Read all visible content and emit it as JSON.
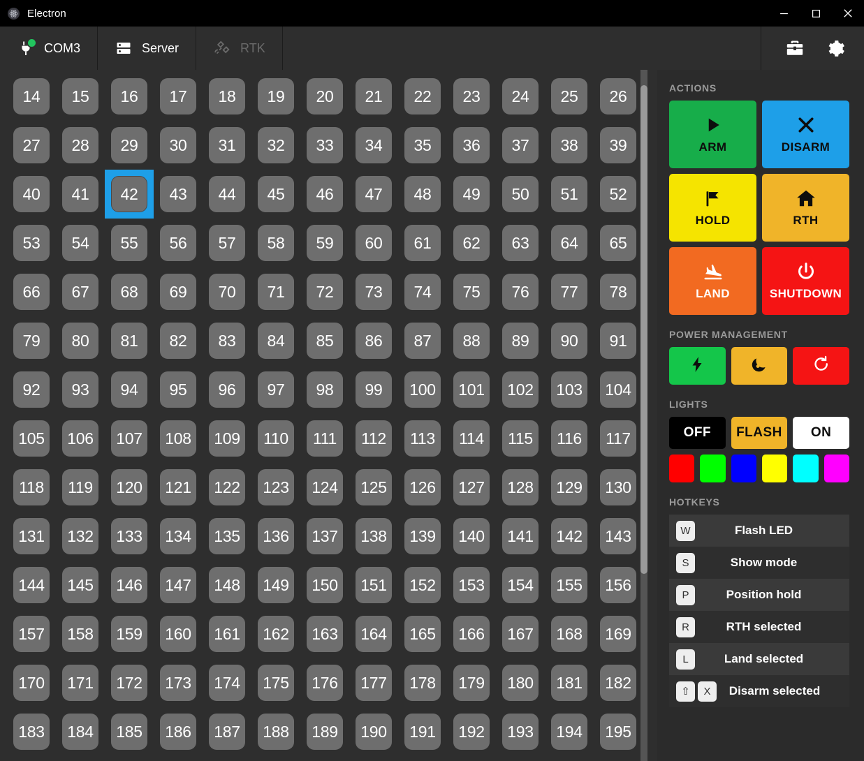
{
  "window": {
    "title": "Electron",
    "app_icon": "atom-icon",
    "controls": [
      {
        "name": "minimize",
        "glyph": "─"
      },
      {
        "name": "maximize",
        "glyph": "□"
      },
      {
        "name": "close",
        "glyph": "✕"
      }
    ]
  },
  "tabs": [
    {
      "label": "COM3",
      "icon": "plug-icon",
      "active": true,
      "disabled": false,
      "status": "connected"
    },
    {
      "label": "Server",
      "icon": "server-icon",
      "active": false,
      "disabled": false
    },
    {
      "label": "RTK",
      "icon": "satellite-icon",
      "active": false,
      "disabled": true
    }
  ],
  "toolbar_icons": [
    {
      "name": "toolbox-icon"
    },
    {
      "name": "gear-icon"
    }
  ],
  "grid": {
    "start": 14,
    "end": 195,
    "columns": 13,
    "selected": 42
  },
  "sidebar": {
    "actions": {
      "title": "ACTIONS",
      "buttons": [
        {
          "label": "ARM",
          "icon": "play-icon",
          "bg": "#17ad4a",
          "fg": "#0d0d0d"
        },
        {
          "label": "DISARM",
          "icon": "cross-icon",
          "bg": "#1e9fe8",
          "fg": "#0d0d0d"
        },
        {
          "label": "HOLD",
          "icon": "flag-icon",
          "bg": "#f5e400",
          "fg": "#0d0d0d"
        },
        {
          "label": "RTH",
          "icon": "home-icon",
          "bg": "#f0b429",
          "fg": "#0d0d0d"
        },
        {
          "label": "LAND",
          "icon": "landing-icon",
          "bg": "#f26a21",
          "fg": "#ffffff"
        },
        {
          "label": "SHUTDOWN",
          "icon": "power-icon",
          "bg": "#f51414",
          "fg": "#ffffff"
        }
      ]
    },
    "power": {
      "title": "POWER MANAGEMENT",
      "buttons": [
        {
          "name": "power-on-button",
          "icon": "bolt-icon",
          "bg": "#14c64a",
          "fg": "#0d0d0d"
        },
        {
          "name": "sleep-button",
          "icon": "moon-icon",
          "bg": "#f0b429",
          "fg": "#0d0d0d"
        },
        {
          "name": "restart-button",
          "icon": "refresh-icon",
          "bg": "#f51414",
          "fg": "#ffffff"
        }
      ]
    },
    "lights": {
      "title": "LIGHTS",
      "modes": [
        {
          "label": "OFF",
          "bg": "#000000",
          "fg": "#ffffff"
        },
        {
          "label": "FLASH",
          "bg": "#f0b429",
          "fg": "#0d0d0d"
        },
        {
          "label": "ON",
          "bg": "#ffffff",
          "fg": "#0d0d0d"
        }
      ],
      "colors": [
        {
          "name": "red",
          "hex": "#FF0000"
        },
        {
          "name": "green",
          "hex": "#00FF00"
        },
        {
          "name": "blue",
          "hex": "#0000FF"
        },
        {
          "name": "yellow",
          "hex": "#FFFF00"
        },
        {
          "name": "cyan",
          "hex": "#00FFFF"
        },
        {
          "name": "magenta",
          "hex": "#FF00FF"
        }
      ]
    },
    "hotkeys": {
      "title": "HOTKEYS",
      "rows": [
        {
          "keys": [
            "W"
          ],
          "label": "Flash LED"
        },
        {
          "keys": [
            "S"
          ],
          "label": "Show mode"
        },
        {
          "keys": [
            "P"
          ],
          "label": "Position hold"
        },
        {
          "keys": [
            "R"
          ],
          "label": "RTH selected"
        },
        {
          "keys": [
            "L"
          ],
          "label": "Land selected"
        },
        {
          "keys": [
            "⇧",
            "X"
          ],
          "label": "Disarm selected"
        }
      ]
    }
  }
}
